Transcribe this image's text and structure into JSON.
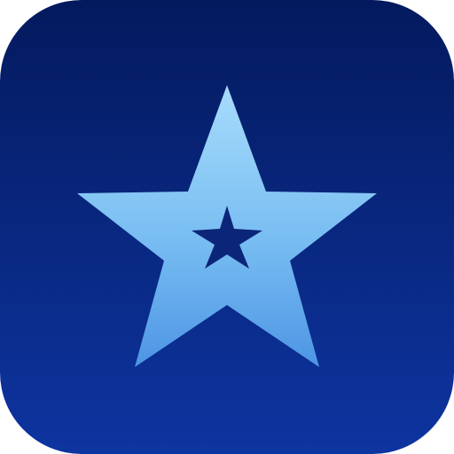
{
  "icon": {
    "name": "star-icon",
    "background_top": "#041a5e",
    "background_bottom": "#0d34a0",
    "star_top": "#a7dcfb",
    "star_bottom": "#4d95e4",
    "inner_star": "#0b2678"
  }
}
